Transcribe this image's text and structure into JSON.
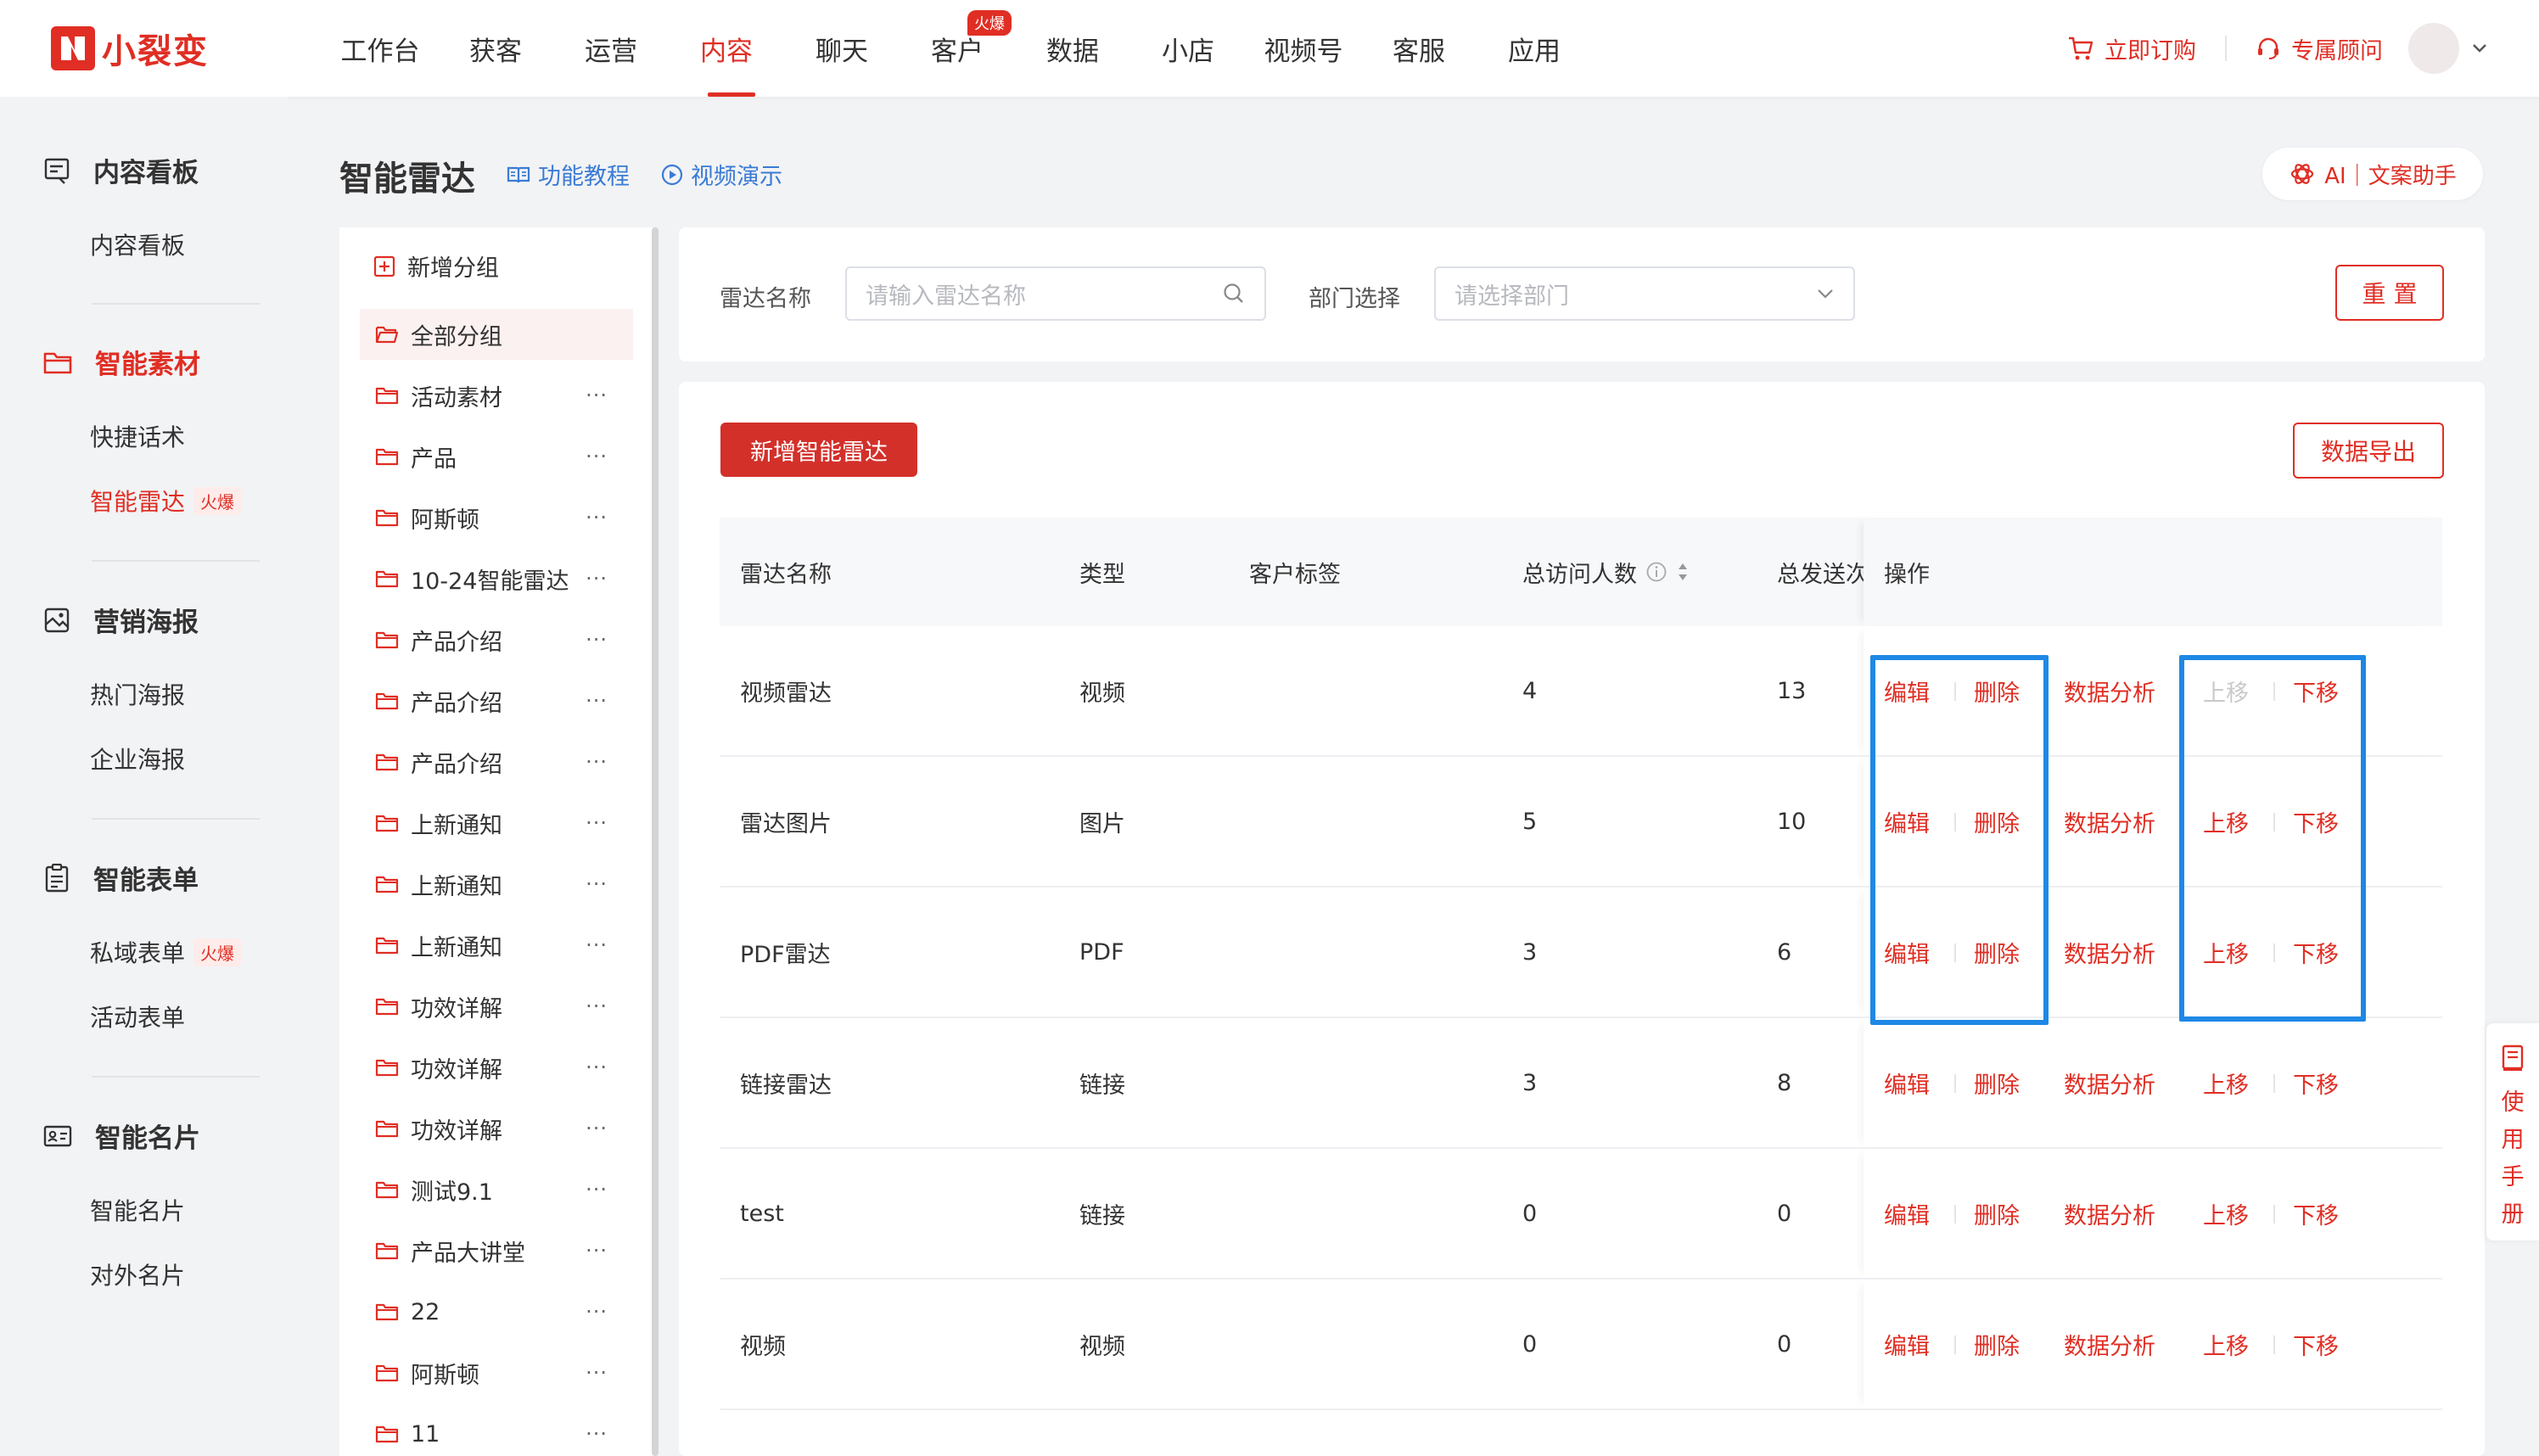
{
  "brand": {
    "name": "小裂变",
    "color": "#e02e24"
  },
  "nav": {
    "items": [
      {
        "label": "工作台"
      },
      {
        "label": "获客"
      },
      {
        "label": "运营"
      },
      {
        "label": "内容"
      },
      {
        "label": "聊天"
      },
      {
        "label": "客户",
        "badge": "火爆"
      },
      {
        "label": "数据"
      },
      {
        "label": "小店"
      },
      {
        "label": "视频号"
      },
      {
        "label": "客服"
      },
      {
        "label": "应用"
      }
    ],
    "active": "内容"
  },
  "topright": {
    "order": "立即订购",
    "consultant": "专属顾问"
  },
  "sidebar": {
    "sections": [
      {
        "title": "内容看板",
        "icon": "dashboard-icon",
        "items": [
          {
            "label": "内容看板"
          }
        ]
      },
      {
        "title": "智能素材",
        "icon": "folder-icon",
        "items": [
          {
            "label": "快捷话术"
          },
          {
            "label": "智能雷达",
            "tag": "火爆"
          }
        ]
      },
      {
        "title": "营销海报",
        "icon": "poster-icon",
        "items": [
          {
            "label": "热门海报"
          },
          {
            "label": "企业海报"
          }
        ]
      },
      {
        "title": "智能表单",
        "icon": "form-icon",
        "items": [
          {
            "label": "私域表单",
            "tag": "火爆"
          },
          {
            "label": "活动表单"
          }
        ]
      },
      {
        "title": "智能名片",
        "icon": "card-icon",
        "items": [
          {
            "label": "智能名片"
          },
          {
            "label": "对外名片"
          }
        ]
      }
    ],
    "active_item": "智能雷达"
  },
  "page": {
    "title": "智能雷达",
    "tutorial_link": "功能教程",
    "video_link": "视频演示",
    "ai_button": "AI｜文案助手"
  },
  "groups": {
    "add_label": "新增分组",
    "items": [
      "全部分组",
      "活动素材",
      "产品",
      "阿斯顿",
      "10-24智能雷达",
      "产品介绍",
      "产品介绍",
      "产品介绍",
      "上新通知",
      "上新通知",
      "上新通知",
      "功效详解",
      "功效详解",
      "功效详解",
      "测试9.1",
      "产品大讲堂",
      "22",
      "阿斯顿",
      "11"
    ],
    "more": "···"
  },
  "filter": {
    "name_label": "雷达名称",
    "name_placeholder": "请输入雷达名称",
    "dept_label": "部门选择",
    "dept_placeholder": "请选择部门",
    "reset": "重 置"
  },
  "toolbar": {
    "add": "新增智能雷达",
    "export": "数据导出"
  },
  "table": {
    "columns": [
      "雷达名称",
      "类型",
      "客户标签",
      "总访问人数",
      "总发送次",
      "操作"
    ],
    "rows": [
      {
        "name": "视频雷达",
        "type": "视频",
        "tag": "",
        "visitors": "4",
        "sends": "13",
        "up_disabled": true
      },
      {
        "name": "雷达图片",
        "type": "图片",
        "tag": "",
        "visitors": "5",
        "sends": "10",
        "up_disabled": false
      },
      {
        "name": "PDF雷达",
        "type": "PDF",
        "tag": "",
        "visitors": "3",
        "sends": "6",
        "up_disabled": false
      },
      {
        "name": "链接雷达",
        "type": "链接",
        "tag": "",
        "visitors": "3",
        "sends": "8",
        "up_disabled": false
      },
      {
        "name": "test",
        "type": "链接",
        "tag": "",
        "visitors": "0",
        "sends": "0",
        "up_disabled": false
      },
      {
        "name": "视频",
        "type": "视频",
        "tag": "",
        "visitors": "0",
        "sends": "0",
        "up_disabled": false
      }
    ],
    "actions": {
      "edit": "编辑",
      "delete": "删除",
      "analyze": "数据分析",
      "up": "上移",
      "down": "下移"
    }
  },
  "manual": {
    "chars": [
      "使",
      "用",
      "手",
      "册"
    ]
  }
}
